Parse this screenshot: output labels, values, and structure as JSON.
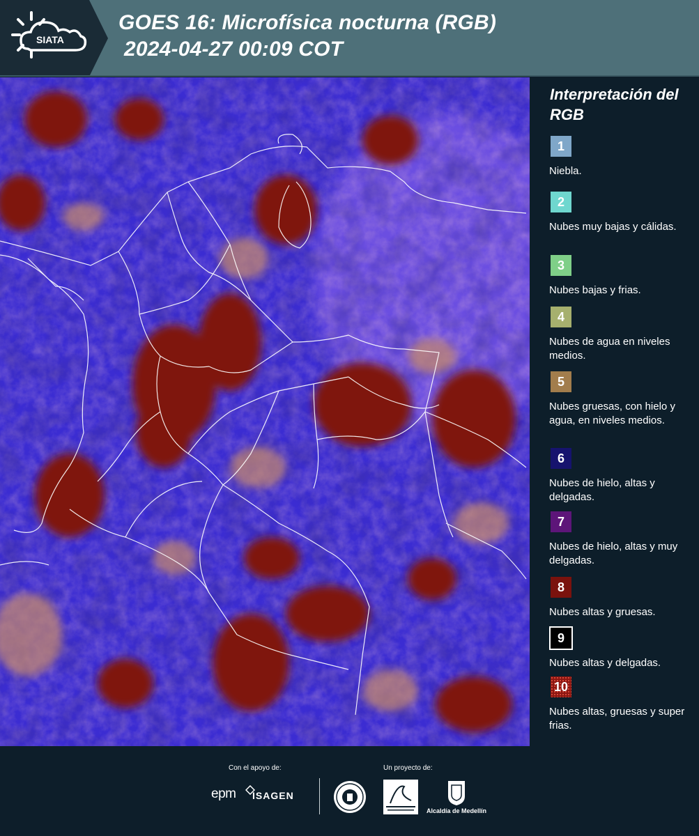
{
  "header": {
    "logo_text": "SIATA",
    "title_line1": "GOES 16: Microfísica nocturna (RGB)",
    "title_line2": "2024-04-27 00:09 COT",
    "background_color": "#4e7079"
  },
  "map": {
    "product": "GOES 16 Microfísica nocturna RGB",
    "dominant_colors": [
      "#3a2ad0",
      "#8b1a14",
      "#6b2c8c",
      "#c87e64"
    ]
  },
  "legend": {
    "title": "Interpretación del RGB",
    "items": [
      {
        "number": "1",
        "label": "Niebla.",
        "color": "#7fa7c9"
      },
      {
        "number": "2",
        "label": "Nubes muy bajas y cálidas.",
        "color": "#6fd7cf"
      },
      {
        "number": "3",
        "label": "Nubes bajas y frias.",
        "color": "#7fcf88"
      },
      {
        "number": "4",
        "label": "Nubes de agua en niveles medios.",
        "color": "#a6b06e"
      },
      {
        "number": "5",
        "label": "Nubes gruesas, con hielo y agua, en niveles medios.",
        "color": "#a27d4c"
      },
      {
        "number": "6",
        "label": "Nubes de hielo, altas y delgadas.",
        "color": "#16136e"
      },
      {
        "number": "7",
        "label": "Nubes de hielo, altas y muy delgadas.",
        "color": "#5d1579"
      },
      {
        "number": "8",
        "label": "Nubes altas y gruesas.",
        "color": "#7a120d"
      },
      {
        "number": "9",
        "label": "Nubes altas y delgadas.",
        "color": "#000000"
      },
      {
        "number": "10",
        "label": "Nubes altas, gruesas y super frias.",
        "color": "#8c1712"
      }
    ]
  },
  "footer": {
    "support_label": "Con el apoyo de:",
    "project_label": "Un proyecto de:",
    "sponsors": [
      "epm",
      "ISAGEN"
    ],
    "partners": [
      "Universidad Nacional seal",
      "Área Metropolitana Valle de Aburrá",
      "Alcaldía de Medellín"
    ],
    "alcaldia_text": "Alcaldía de Medellín"
  }
}
